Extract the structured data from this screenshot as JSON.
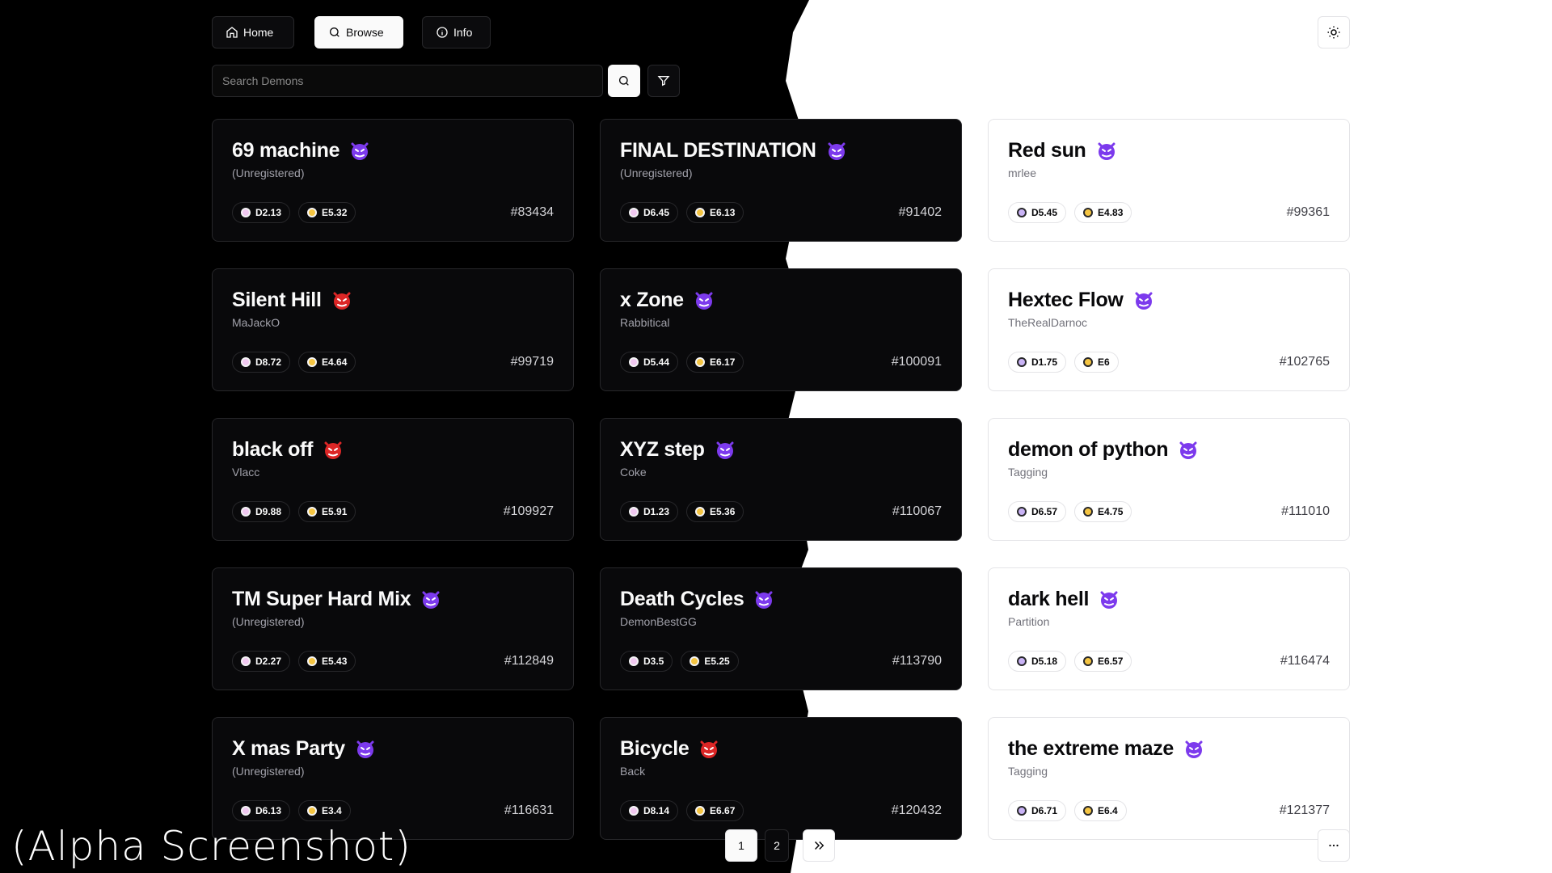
{
  "nav": {
    "home_label": "Home",
    "browse_label": "Browse",
    "info_label": "Info",
    "home_icon": "home-icon",
    "browse_icon": "search-icon",
    "info_icon": "info-icon"
  },
  "search": {
    "placeholder": "Search Demons"
  },
  "theme_icon": "sun-icon",
  "colors": {
    "d_dot_dark": "#f0c8f0",
    "d_dot_light": "#c9b3f5",
    "e_dot": "#f5c542",
    "face_purple": "#7c3aed",
    "face_red": "#dc2626"
  },
  "demons": [
    {
      "name": "69 machine",
      "author": "(Unregistered)",
      "d": "D2.13",
      "e": "E5.32",
      "id": "#83434",
      "face": "purple"
    },
    {
      "name": "FINAL DESTINATION",
      "author": "(Unregistered)",
      "d": "D6.45",
      "e": "E6.13",
      "id": "#91402",
      "face": "purple"
    },
    {
      "name": "Red sun",
      "author": "mrlee",
      "d": "D5.45",
      "e": "E4.83",
      "id": "#99361",
      "face": "purple"
    },
    {
      "name": "Silent Hill",
      "author": "MaJackO",
      "d": "D8.72",
      "e": "E4.64",
      "id": "#99719",
      "face": "red"
    },
    {
      "name": "x Zone",
      "author": "Rabbitical",
      "d": "D5.44",
      "e": "E6.17",
      "id": "#100091",
      "face": "purple"
    },
    {
      "name": "Hextec Flow",
      "author": "TheRealDarnoc",
      "d": "D1.75",
      "e": "E6",
      "id": "#102765",
      "face": "purple"
    },
    {
      "name": "black off",
      "author": "Vlacc",
      "d": "D9.88",
      "e": "E5.91",
      "id": "#109927",
      "face": "red"
    },
    {
      "name": "XYZ step",
      "author": "Coke",
      "d": "D1.23",
      "e": "E5.36",
      "id": "#110067",
      "face": "purple"
    },
    {
      "name": "demon of python",
      "author": "Tagging",
      "d": "D6.57",
      "e": "E4.75",
      "id": "#111010",
      "face": "purple"
    },
    {
      "name": "TM Super Hard Mix",
      "author": "(Unregistered)",
      "d": "D2.27",
      "e": "E5.43",
      "id": "#112849",
      "face": "purple"
    },
    {
      "name": "Death Cycles",
      "author": "DemonBestGG",
      "d": "D3.5",
      "e": "E5.25",
      "id": "#113790",
      "face": "purple"
    },
    {
      "name": "dark hell",
      "author": "Partition",
      "d": "D5.18",
      "e": "E6.57",
      "id": "#116474",
      "face": "purple"
    },
    {
      "name": "X mas Party",
      "author": "(Unregistered)",
      "d": "D6.13",
      "e": "E3.4",
      "id": "#116631",
      "face": "purple"
    },
    {
      "name": "Bicycle",
      "author": "Back",
      "d": "D8.14",
      "e": "E6.67",
      "id": "#120432",
      "face": "red"
    },
    {
      "name": "the extreme maze",
      "author": "Tagging",
      "d": "D6.71",
      "e": "E6.4",
      "id": "#121377",
      "face": "purple"
    }
  ],
  "pagination": {
    "current": "1",
    "next_page": "2",
    "last_icon": "double-chevron-right-icon",
    "more_icon": "ellipsis-icon"
  },
  "watermark": "(Alpha Screenshot)"
}
